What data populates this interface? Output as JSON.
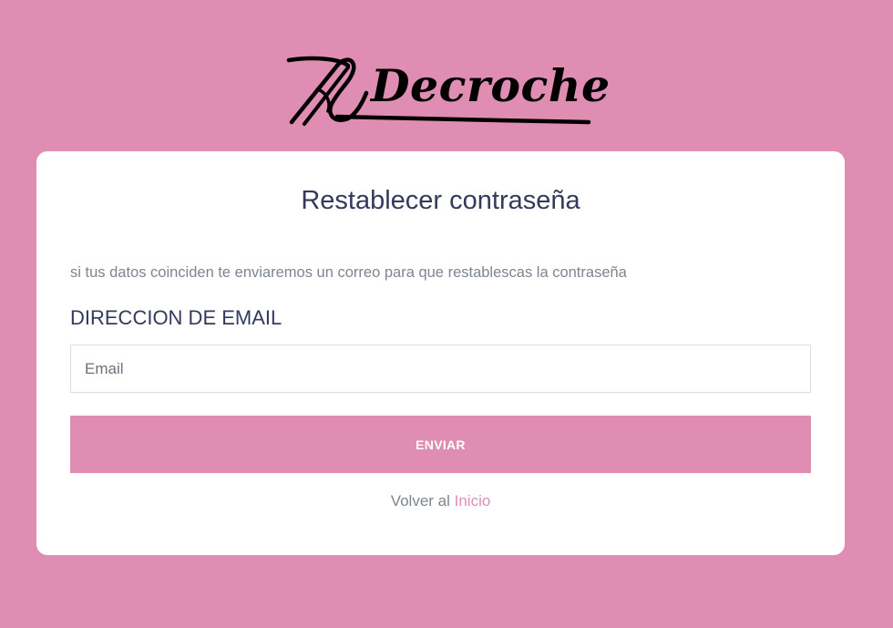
{
  "logo": {
    "text": "Decroche",
    "icon": "needle-thread-icon"
  },
  "card": {
    "title": "Restablecer contraseña",
    "help_text": "si tus datos coinciden te enviaremos un correo para que restablescas la contraseña",
    "email_label": "DIRECCION DE EMAIL",
    "email_placeholder": "Email",
    "email_value": "",
    "submit_label": "ENVIAR",
    "back_prefix": "Volver al",
    "back_link_label": "Inicio"
  },
  "colors": {
    "background": "#df8db2",
    "card": "#ffffff",
    "heading": "#343a5a",
    "muted_text": "#7d8590",
    "accent": "#df8db2"
  }
}
